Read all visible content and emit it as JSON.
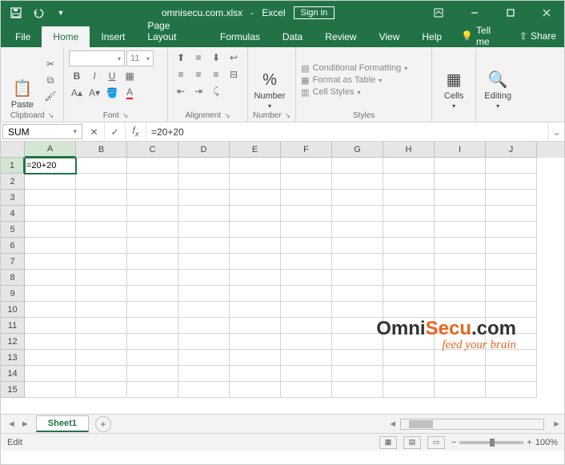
{
  "titlebar": {
    "docname": "omnisecu.com.xlsx",
    "appname": "Excel",
    "signin": "Sign in"
  },
  "tabs": {
    "file": "File",
    "home": "Home",
    "insert": "Insert",
    "page_layout": "Page Layout",
    "formulas": "Formulas",
    "data": "Data",
    "review": "Review",
    "view": "View",
    "help": "Help",
    "tell_me": "Tell me",
    "share": "Share"
  },
  "ribbon": {
    "clipboard": {
      "label": "Clipboard",
      "paste": "Paste"
    },
    "font": {
      "label": "Font",
      "name_placeholder": "",
      "size": "11"
    },
    "alignment": {
      "label": "Alignment"
    },
    "number": {
      "label": "Number",
      "btn": "Number",
      "symbol": "%"
    },
    "styles": {
      "label": "Styles",
      "cond": "Conditional Formatting",
      "table": "Format as Table",
      "cellstyles": "Cell Styles"
    },
    "cells": {
      "label": "Cells",
      "btn": "Cells"
    },
    "editing": {
      "label": "Editing",
      "btn": "Editing"
    }
  },
  "formula_bar": {
    "namebox": "SUM",
    "formula": "=20+20"
  },
  "grid": {
    "columns": [
      "A",
      "B",
      "C",
      "D",
      "E",
      "F",
      "G",
      "H",
      "I",
      "J"
    ],
    "rows": [
      1,
      2,
      3,
      4,
      5,
      6,
      7,
      8,
      9,
      10,
      11,
      12,
      13,
      14,
      15
    ],
    "active_cell": "A1",
    "cell_A1": "=20+20"
  },
  "sheets": {
    "active": "Sheet1"
  },
  "statusbar": {
    "mode": "Edit",
    "zoom": "100%"
  },
  "watermark": {
    "brand1": "Omni",
    "brand2": "Secu",
    "brand3": ".com",
    "tagline": "feed your brain"
  }
}
